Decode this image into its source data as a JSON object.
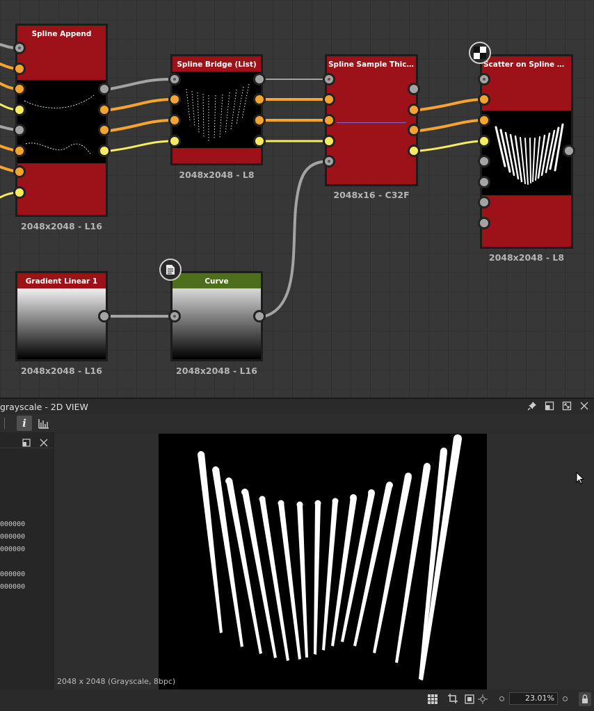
{
  "graph": {
    "nodes": {
      "spline_append": {
        "title": "Spline Append",
        "resolution": "2048x2048 - L16"
      },
      "spline_bridge": {
        "title": "Spline Bridge (List)",
        "resolution": "2048x2048 - L8"
      },
      "spline_sample_thickness": {
        "title": "Spline Sample Thickness",
        "resolution": "2048x16 - C32F"
      },
      "scatter_on_spline": {
        "title": "Scatter on Spline Graysc...",
        "resolution": "2048x2048 - L8"
      },
      "gradient_linear": {
        "title": "Gradient Linear 1",
        "resolution": "2048x2048 - L16"
      },
      "curve": {
        "title": "Curve",
        "resolution": "2048x2048 - L16"
      }
    },
    "colors": {
      "node_red": "#9d1219",
      "node_green": "#4d6e1a",
      "port_gray": "#a4a4a4",
      "port_orange": "#f5a431",
      "port_yellow": "#f8eb64"
    }
  },
  "panel": {
    "title": "grayscale - 2D VIEW",
    "left_values": [
      "000000",
      "000000",
      "000000",
      "000000",
      "000000"
    ],
    "view_status": "2048 x 2048 (Grayscale, 8bpc)",
    "zoom": "23.01%"
  },
  "icons": [
    "checker-icon",
    "document-icon",
    "pin-icon",
    "restore-icon",
    "maximize-icon",
    "close-icon",
    "info-icon",
    "histogram-icon",
    "grid-icon",
    "fit-icon",
    "frame-icon",
    "center-icon",
    "lock-icon"
  ]
}
